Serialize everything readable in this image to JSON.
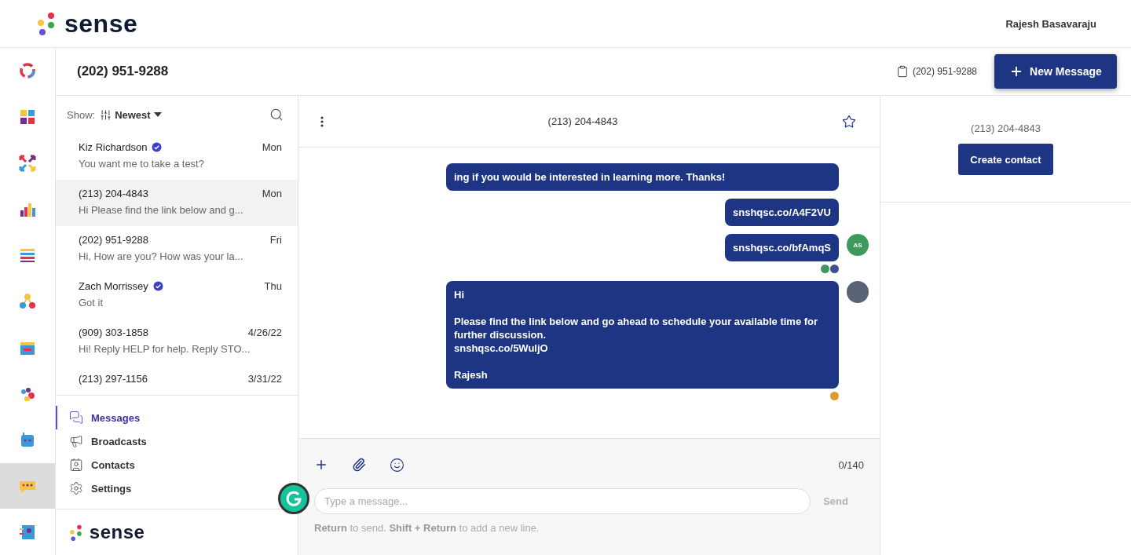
{
  "header": {
    "logo": "sense",
    "user": "Rajesh Basavaraju"
  },
  "rail": {
    "items": [
      {
        "kind": "ring",
        "selected": false
      },
      {
        "kind": "grid",
        "selected": false
      },
      {
        "kind": "arrows",
        "selected": false
      },
      {
        "kind": "chart",
        "selected": false
      },
      {
        "kind": "list",
        "selected": false
      },
      {
        "kind": "network",
        "selected": false
      },
      {
        "kind": "calendar",
        "selected": false
      },
      {
        "kind": "team",
        "selected": false
      },
      {
        "kind": "bot",
        "selected": false
      },
      {
        "kind": "chat",
        "selected": true
      },
      {
        "kind": "profile",
        "selected": false
      }
    ]
  },
  "subheader": {
    "title": "(202) 951-9288",
    "line_number": "(202) 951-9288",
    "new_button": "New Message"
  },
  "conversations": {
    "show_label": "Show:",
    "sort": "Newest",
    "items": [
      {
        "name": "Kiz Richardson",
        "verified": true,
        "time": "Mon",
        "preview": "You want me to take a test?",
        "selected": false
      },
      {
        "name": "(213) 204-4843",
        "verified": false,
        "time": "Mon",
        "preview": "Hi Please find the link below and g...",
        "selected": true
      },
      {
        "name": "(202) 951-9288",
        "verified": false,
        "time": "Fri",
        "preview": "Hi, How are you? How was your la...",
        "selected": false
      },
      {
        "name": "Zach Morrissey",
        "verified": true,
        "time": "Thu",
        "preview": "Got it",
        "selected": false
      },
      {
        "name": "(909) 303-1858",
        "verified": false,
        "time": "4/26/22",
        "preview": "Hi! Reply HELP for help. Reply STO...",
        "selected": false
      },
      {
        "name": "(213) 297-1156",
        "verified": false,
        "time": "3/31/22",
        "selected": false
      }
    ]
  },
  "nav": [
    {
      "kind": "messages",
      "label": "Messages",
      "selected": true
    },
    {
      "kind": "broadcasts",
      "label": "Broadcasts",
      "selected": false
    },
    {
      "kind": "contacts",
      "label": "Contacts",
      "selected": false
    },
    {
      "kind": "settings",
      "label": "Settings",
      "selected": false
    }
  ],
  "footer_logo": "sense",
  "chat": {
    "title": "(213) 204-4843",
    "starred": false,
    "messages": [
      {
        "text": "ing if you would be interested in learning more. Thanks!"
      },
      {
        "text": "snshqsc.co/A4F2VU"
      },
      {
        "text": "snshqsc.co/bfAmqS",
        "avatar": {
          "kind": "initials",
          "text": "AS",
          "color": "#3e9a5c"
        },
        "receipts": [
          {
            "color": "#3e9a5c"
          },
          {
            "color": "#3d4f8f"
          }
        ]
      },
      {
        "text": "Hi\n\nPlease find the link below and go ahead to schedule your available time for further discussion.\nsnshqsc.co/5WuljO\n\nRajesh",
        "avatar": {
          "kind": "photo"
        },
        "receipts": [
          {
            "color": "#e09a2c"
          }
        ]
      }
    ],
    "counter": "0/140",
    "placeholder": "Type a message...",
    "send": "Send",
    "hint": "**Return** to send. **Shift + Return** to add a new line."
  },
  "contact_panel": {
    "number": "(213) 204-4843",
    "button": "Create contact"
  }
}
